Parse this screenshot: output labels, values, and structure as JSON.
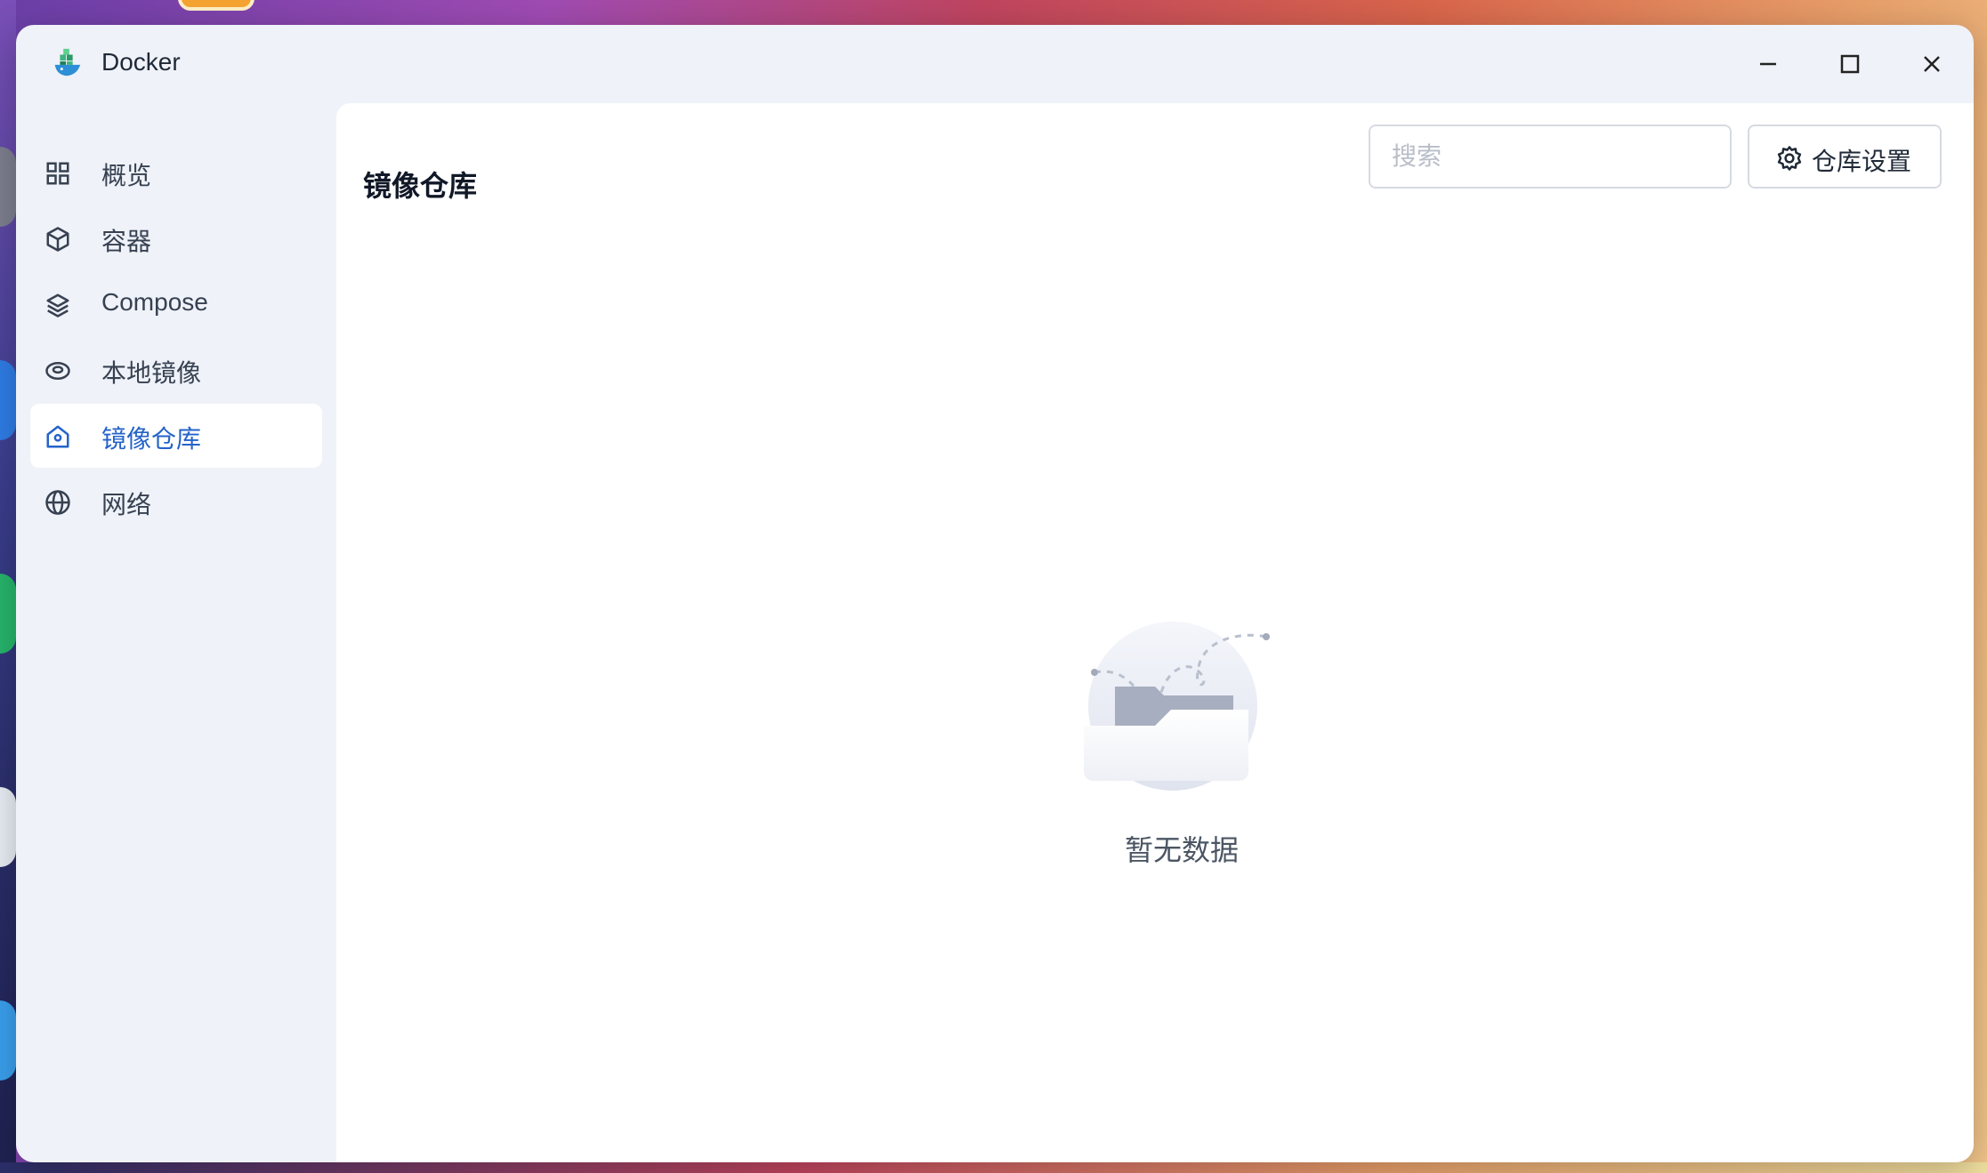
{
  "app": {
    "title": "Docker",
    "logo_icon": "docker-whale-logo-icon"
  },
  "window_controls": {
    "minimize_icon": "minimize-icon",
    "maximize_icon": "maximize-icon",
    "close_icon": "close-icon"
  },
  "sidebar": {
    "items": [
      {
        "label": "概览",
        "icon": "grid-icon",
        "active": false
      },
      {
        "label": "容器",
        "icon": "cube-icon",
        "active": false
      },
      {
        "label": "Compose",
        "icon": "layers-icon",
        "active": false
      },
      {
        "label": "本地镜像",
        "icon": "disk-icon",
        "active": false
      },
      {
        "label": "镜像仓库",
        "icon": "home-icon",
        "active": true
      },
      {
        "label": "网络",
        "icon": "globe-icon",
        "active": false
      }
    ]
  },
  "main": {
    "title": "镜像仓库",
    "search": {
      "placeholder": "搜索",
      "value": ""
    },
    "settings_button": {
      "label": "仓库设置",
      "icon": "gear-icon"
    },
    "empty_state": {
      "text": "暂无数据",
      "icon": "empty-folder-icon"
    }
  },
  "colors": {
    "accent": "#2563c9",
    "window_bg": "#eff2f8",
    "content_bg": "#ffffff",
    "text_primary": "#111827",
    "text_secondary": "#374151"
  }
}
